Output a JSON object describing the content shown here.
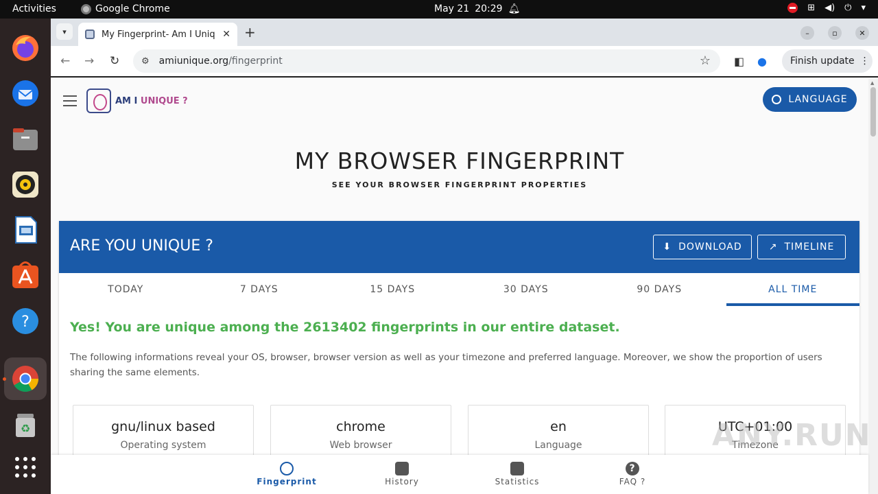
{
  "topbar": {
    "activities": "Activities",
    "app_name": "Google Chrome",
    "date": "May 21",
    "time": "20:29"
  },
  "dock": {
    "items": [
      "firefox-icon",
      "thunderbird-icon",
      "files-icon",
      "rhythmbox-icon",
      "libreoffice-impress-icon",
      "app-center-icon",
      "help-icon",
      "chrome-icon",
      "trash-icon",
      "app-grid-icon"
    ]
  },
  "browser": {
    "tab_title": "My Fingerprint- Am I Unique",
    "url_host": "amiunique.org",
    "url_path": "/fingerprint",
    "finish_update": "Finish update"
  },
  "site": {
    "logo_text": "AM I ",
    "logo_text2": "UNIQUE ?",
    "language_button": "LANGUAGE",
    "title": "MY BROWSER FINGERPRINT",
    "subtitle": "SEE YOUR BROWSER FINGERPRINT PROPERTIES",
    "card_title": "ARE YOU UNIQUE ?",
    "download_button": "DOWNLOAD",
    "timeline_button": "TIMELINE",
    "tabs": [
      "TODAY",
      "7 DAYS",
      "15 DAYS",
      "30 DAYS",
      "90 DAYS",
      "ALL TIME"
    ],
    "selected_tab": "ALL TIME",
    "unique_message": "Yes! You are unique among the 2613402 fingerprints in our entire dataset.",
    "description": "The following informations reveal your OS, browser, browser version as well as your timezone and preferred language. Moreover, we show the proportion of users sharing the same elements.",
    "properties": [
      {
        "value": "gnu/linux based",
        "label": "Operating system"
      },
      {
        "value": "chrome",
        "label": "Web browser"
      },
      {
        "value": "en",
        "label": "Language"
      },
      {
        "value": "UTC+01:00",
        "label": "Timezone"
      }
    ],
    "bottom_nav": [
      "Fingerprint",
      "History",
      "Statistics",
      "FAQ ?"
    ]
  },
  "watermark": "ANY.RUN",
  "colors": {
    "primary": "#1a5aa8",
    "success": "#4caf50"
  }
}
